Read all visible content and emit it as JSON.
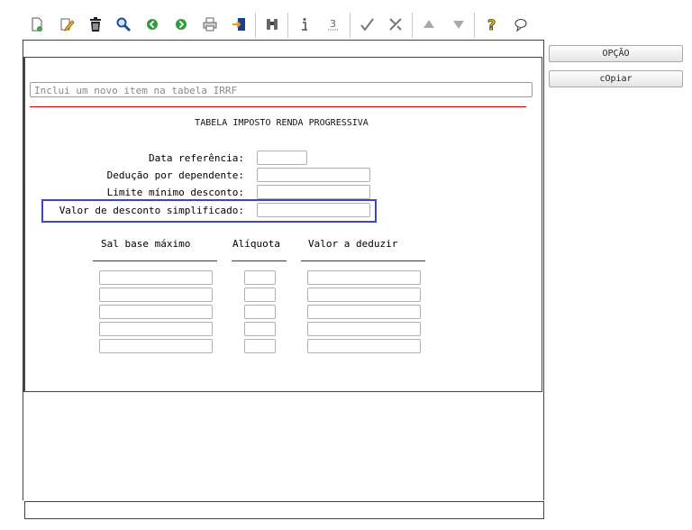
{
  "side_buttons": {
    "option": "OPÇÃO",
    "copy": "cOpiar"
  },
  "message": {
    "text": "Inclui um novo item na tabela IRRF"
  },
  "form": {
    "title": "TABELA IMPOSTO RENDA PROGRESSIVA",
    "fields": {
      "data_referencia": {
        "label": "Data referência:",
        "value": ""
      },
      "deducao_dependente": {
        "label": "Dedução por dependente:",
        "value": ""
      },
      "limite_minimo": {
        "label": "Limite mínimo desconto:",
        "value": ""
      },
      "desconto_simplificado": {
        "label": "Valor de desconto simplificado:",
        "value": ""
      }
    }
  },
  "table": {
    "headers": {
      "sal_base": "Sal base máximo",
      "aliquota": "Alíquota",
      "valor_deduzir": "Valor a deduzir"
    }
  },
  "toolbar_icons": [
    "new-document-icon",
    "edit-icon",
    "trash-icon",
    "search-icon",
    "back-icon",
    "forward-icon",
    "print-icon",
    "exit-icon",
    "binoculars-icon",
    "info-icon",
    "help-digit-icon",
    "confirm-check-icon",
    "cancel-icon",
    "up-arrow-icon",
    "down-arrow-icon",
    "help-question-icon",
    "comment-icon"
  ],
  "colors": {
    "highlight": "#3b48b5",
    "separator_red": "#cc0000",
    "icon_green": "#2e9e3c"
  }
}
